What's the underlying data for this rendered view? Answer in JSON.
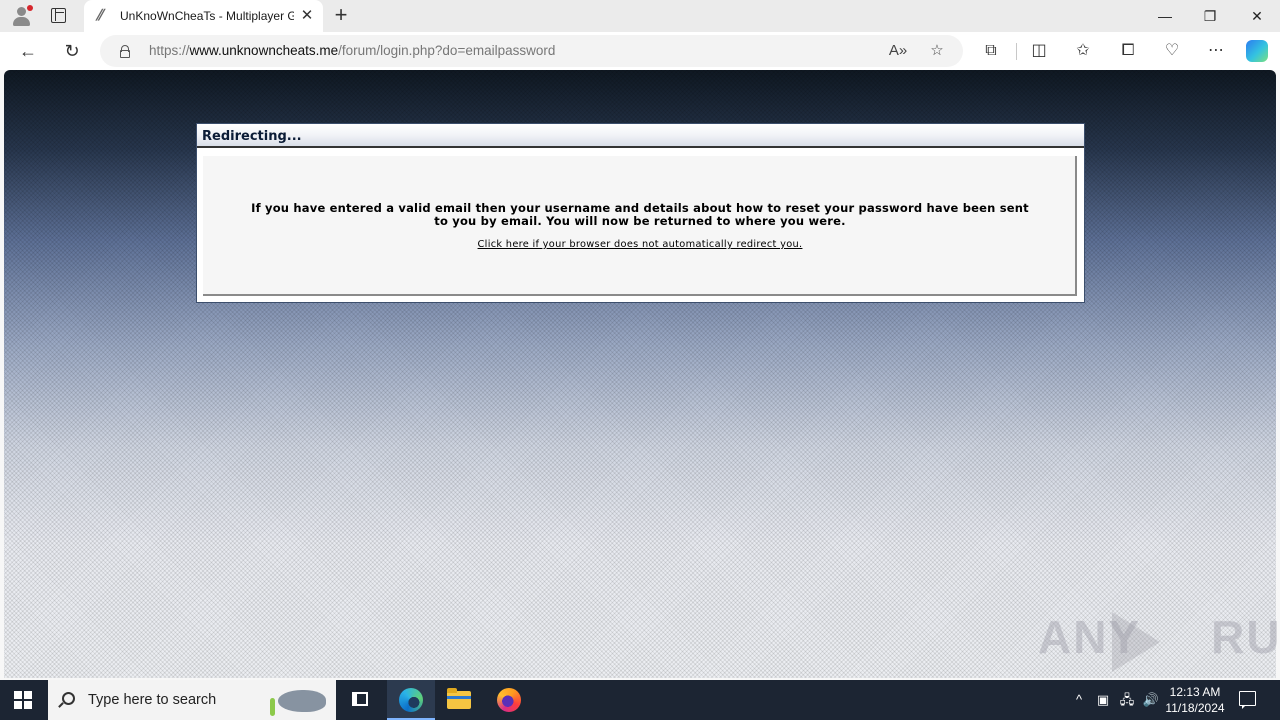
{
  "browser": {
    "tab_title": "UnKnoWnCheaTs - Multiplayer G",
    "tab_close": "✕",
    "new_tab": "+",
    "window_controls": {
      "minimize": "—",
      "restore": "❐",
      "close": "✕"
    },
    "url_prefix": "https://",
    "url_host": "www.unknowncheats.me",
    "url_path": "/forum/login.php?do=emailpassword"
  },
  "page": {
    "panel_title": "Redirecting...",
    "message_line1": "If you have entered a valid email then your username and details about how to reset your password have been sent",
    "message_line2": "to you by email. You will now be returned to where you were.",
    "redirect_link": "Click here if your browser does not automatically redirect you.",
    "watermark": "ANY",
    "watermark_end": "RUN"
  },
  "taskbar": {
    "search_placeholder": "Type here to search",
    "time": "12:13 AM",
    "date": "11/18/2024"
  }
}
